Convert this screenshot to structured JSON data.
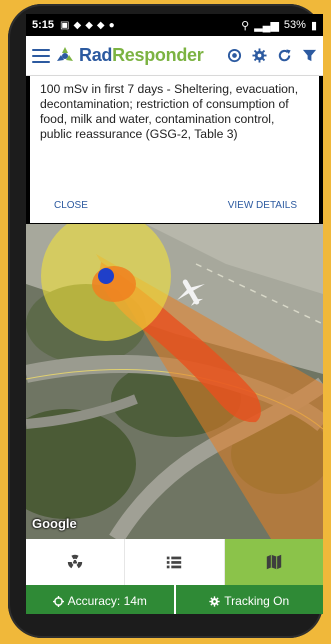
{
  "statusbar": {
    "time": "5:15",
    "battery": "53%"
  },
  "header": {
    "brand_rad": "Rad",
    "brand_responder": "Responder",
    "icons": [
      "menu-icon",
      "target-icon",
      "gear-icon",
      "refresh-icon",
      "filter-icon"
    ]
  },
  "info_card": {
    "text": "100 mSv in first 7 days - Sheltering, evacuation, decontamination; restriction of consumption of food, milk and water, contamination control, public reassurance (GSG-2, Table 3)",
    "close_label": "CLOSE",
    "details_label": "VIEW DETAILS"
  },
  "map": {
    "attribution": "Google"
  },
  "tabs": [
    {
      "icon": "radiation-icon",
      "active": false
    },
    {
      "icon": "list-icon",
      "active": false
    },
    {
      "icon": "map-icon",
      "active": true
    }
  ],
  "footer": {
    "accuracy_label": "Accuracy: 14m",
    "tracking_label": "Tracking On"
  },
  "colors": {
    "brand_blue": "#2c5aa0",
    "brand_green": "#7cb342",
    "active_tab": "#8bc34a",
    "footer_green": "#2f8a36"
  }
}
